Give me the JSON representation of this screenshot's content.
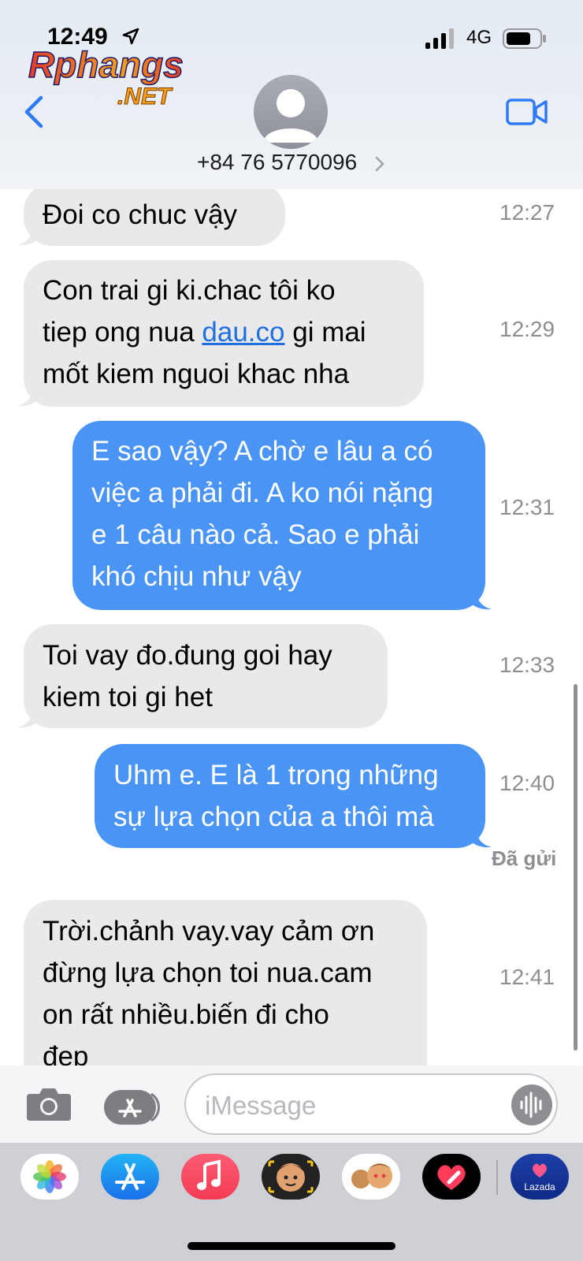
{
  "status_bar": {
    "time": "12:49",
    "network": "4G"
  },
  "watermark": {
    "line1": "Rphangs",
    "line2": ".NET"
  },
  "header": {
    "contact": "+84 76 5770096"
  },
  "messages": [
    {
      "lines": [
        "Đoi co chuc vậy"
      ],
      "time": "12:27"
    },
    {
      "lines": [
        "Con trai gi ki.chac tôi ko",
        "tiep ong nua ",
        "dau.co",
        " gi mai",
        "mốt kiem nguoi khac nha"
      ],
      "time": "12:29"
    },
    {
      "lines": [
        "E sao vậy? A chờ e lâu a có",
        "việc a phải đi. A ko nói nặng",
        "e 1 câu nào cả. Sao e phải",
        "khó chịu như vậy"
      ],
      "time": "12:31"
    },
    {
      "lines": [
        "Toi vay đo.đung goi hay",
        "kiem toi gi het"
      ],
      "time": "12:33"
    },
    {
      "lines": [
        "Uhm e. E là 1 trong những",
        "sự lựa chọn của a thôi mà"
      ],
      "time": "12:40"
    },
    {
      "lines": [
        "Trời.chảnh vay.vay cảm ơn",
        "đừng lựa chọn toi nua.cam",
        "on rất nhiều.biến đi cho",
        "đep"
      ],
      "time": "12:41"
    }
  ],
  "delivered": "Đã gửi",
  "compose": {
    "placeholder": "iMessage"
  },
  "app_tray": {
    "lazada_label": "Lazada"
  },
  "colors": {
    "outgoing": "#4a94f6",
    "incoming": "#e9e9eb",
    "accent": "#1a73e8"
  }
}
